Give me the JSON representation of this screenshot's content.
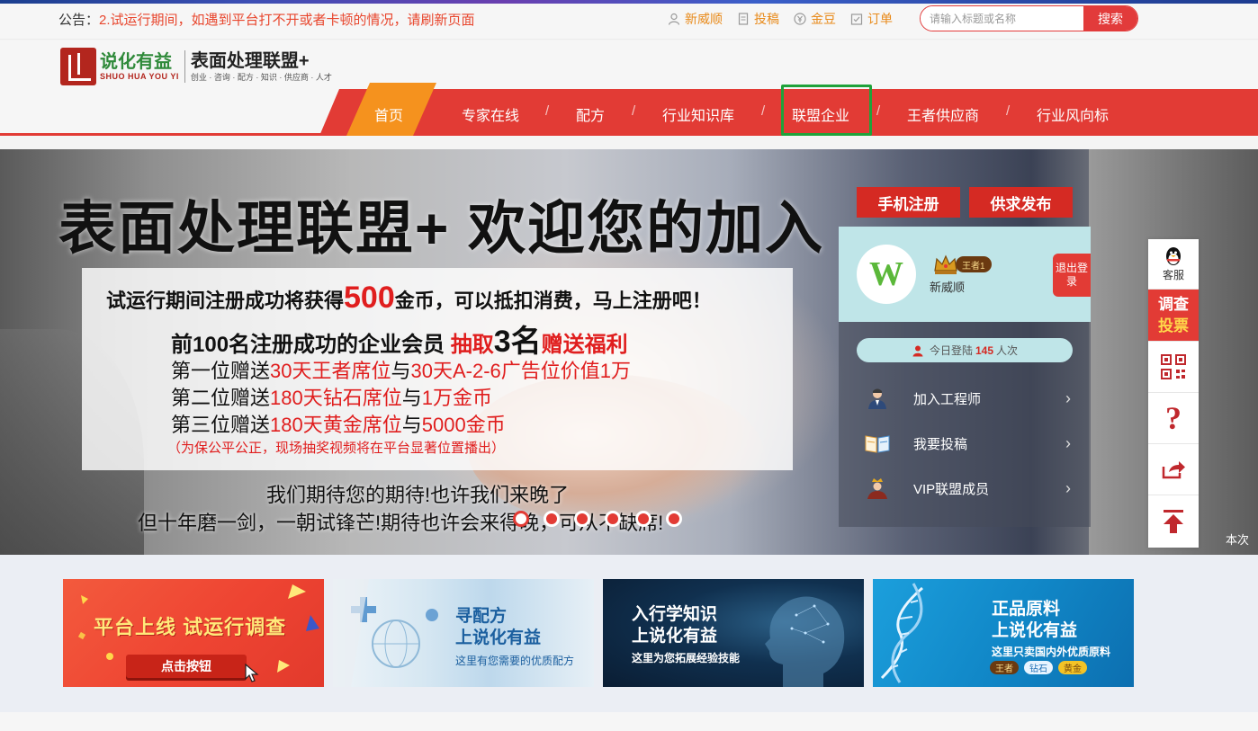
{
  "notice": {
    "label": "公告：",
    "text": "2.试运行期间，如遇到平台打不开或者卡顿的情况，请刷新页面"
  },
  "top_links": [
    {
      "label": "新威顺",
      "icon": "user-icon"
    },
    {
      "label": "投稿",
      "icon": "document-icon"
    },
    {
      "label": "金豆",
      "icon": "yen-coin-icon"
    },
    {
      "label": "订单",
      "icon": "order-check-icon"
    }
  ],
  "search": {
    "placeholder": "请输入标题或名称",
    "button": "搜索"
  },
  "logo": {
    "name": "说化有益",
    "pinyin": "SHUO HUA YOU YI",
    "slogan": "表面处理联盟+",
    "tagline": "创业 · 咨询 · 配方 · 知识 · 供应商 · 人才"
  },
  "nav": {
    "home": "首页",
    "items": [
      "专家在线",
      "配方",
      "行业知识库",
      "联盟企业",
      "王者供应商",
      "行业风向标"
    ],
    "separator": "/"
  },
  "banner": {
    "title": "表面处理联盟+ 欢迎您的加入",
    "promo_pre": "试运行期间注册成功将获得",
    "promo_amount": "500",
    "promo_post": "金币，可以抵扣消费，马上注册吧！",
    "draw_pre": "前100名注册成功的企业会员 ",
    "draw_red": "抽取",
    "draw_num": "3名",
    "draw_post": "赠送福利",
    "prizes": [
      {
        "rank": "第一位赠送",
        "a": "30天王者席位",
        "mid": "与",
        "b": "30天A-2-6广告位价值1万"
      },
      {
        "rank": "第二位赠送",
        "a": "180天钻石席位",
        "mid": "与",
        "b": "1万金币"
      },
      {
        "rank": "第三位赠送",
        "a": "180天黄金席位",
        "mid": "与",
        "b": "5000金币"
      }
    ],
    "note": "（为保公平公正，现场抽奖视频将在平台显著位置播出）",
    "slogan1": "我们期待您的期待!也许我们来晚了",
    "slogan2": "但十年磨一剑，一朝试锋芒!期待也许会来得晚，可从不缺席!",
    "slide_count": 6,
    "active_slide": 1
  },
  "user_panel": {
    "register_btn": "手机注册",
    "publish_btn": "供求发布",
    "avatar_letter": "W",
    "badge": "王者1",
    "username": "新威顺",
    "logout": "退出登录",
    "login_pre": "今日登陆",
    "login_count": "145",
    "login_post": "人次",
    "menu": [
      {
        "label": "加入工程师",
        "icon": "engineer-icon"
      },
      {
        "label": "我要投稿",
        "icon": "submit-article-icon"
      },
      {
        "label": "VIP联盟成员",
        "icon": "vip-member-icon"
      }
    ]
  },
  "float_bar": {
    "service_label": "客服",
    "survey_top": "调查",
    "survey_bottom": "投票",
    "help": "?"
  },
  "side_tail": "本次",
  "cards": {
    "c1_title": "平台上线  试运行调查",
    "c1_btn": "点击按钮",
    "c2_title1": "寻配方",
    "c2_title2": "上说化有益",
    "c2_sub": "这里有您需要的优质配方",
    "c3_title1": "入行学知识",
    "c3_title2": "上说化有益",
    "c3_sub": "这里为您拓展经验技能",
    "c4_title1": "正品原料",
    "c4_title2": "上说化有益",
    "c4_sub": "这里只卖国内外优质原料",
    "c4_tiers": [
      "王者",
      "钻石",
      "黄金"
    ]
  },
  "colors": {
    "brand_red": "#e23b35",
    "accent_orange": "#f5921e",
    "highlight_green": "#1fa23a"
  }
}
